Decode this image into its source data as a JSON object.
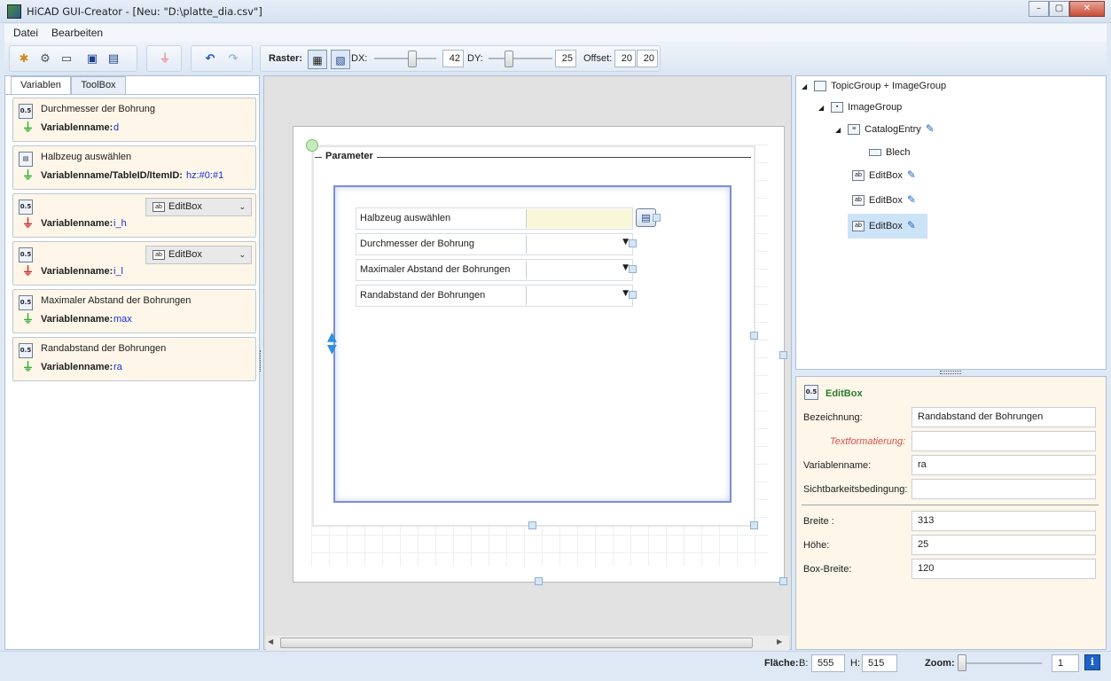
{
  "window": {
    "title": "HiCAD GUI-Creator - [Neu: \"D:\\platte_dia.csv\"]",
    "min": "–",
    "max": "▢",
    "close": "✕"
  },
  "menu": {
    "file": "Datei",
    "edit": "Bearbeiten"
  },
  "toolbar": {
    "raster_label": "Raster:",
    "dx_label": "DX:",
    "dx_value": "42",
    "dy_label": "DY:",
    "dy_value": "25",
    "offset_label": "Offset:",
    "offset_x": "20",
    "offset_y": "20"
  },
  "tabs": {
    "variables": "Variablen",
    "toolbox": "ToolBox"
  },
  "variables": [
    {
      "title": "Durchmesser der Bohrung",
      "label": "Variablenname:",
      "value": "d",
      "plug": "green"
    },
    {
      "title": "Halbzeug auswählen",
      "label": "Variablenname/TableID/ItemID:",
      "value": "hz:#0:#1",
      "plug": "green"
    },
    {
      "combo": "EditBox",
      "label": "Variablenname:",
      "value": "i_h",
      "plug": "red"
    },
    {
      "combo": "EditBox",
      "label": "Variablenname:",
      "value": "i_l",
      "plug": "red"
    },
    {
      "title": "Maximaler Abstand der Bohrungen",
      "label": "Variablenname:",
      "value": "max",
      "plug": "green"
    },
    {
      "title": "Randabstand der Bohrungen",
      "label": "Variablenname:",
      "value": "ra",
      "plug": "green"
    }
  ],
  "form": {
    "group_title": "Parameter",
    "fields": [
      "Halbzeug auswählen",
      "Durchmesser der Bohrung",
      "Maximaler Abstand der Bohrungen",
      "Randabstand der Bohrungen"
    ]
  },
  "tree": {
    "root": "TopicGroup + ImageGroup",
    "image_group": "ImageGroup",
    "catalog_entry": "CatalogEntry",
    "blech": "Blech",
    "editbox1": "EditBox",
    "editbox2": "EditBox",
    "editbox3": "EditBox"
  },
  "properties": {
    "type": "EditBox",
    "bezeichnung_label": "Bezeichnung:",
    "bezeichnung_value": "Randabstand der Bohrungen",
    "textformat_label": "Textformatierung:",
    "textformat_value": "",
    "variablenname_label": "Variablenname:",
    "variablenname_value": "ra",
    "sichtbarkeit_label": "Sichtbarkeitsbedingung:",
    "sichtbarkeit_value": "",
    "breite_label": "Breite :",
    "breite_value": "313",
    "hoehe_label": "Höhe:",
    "hoehe_value": "25",
    "boxbreite_label": "Box-Breite:",
    "boxbreite_value": "120"
  },
  "status": {
    "flaeche_label": "Fläche:",
    "b_label": "B:",
    "b_value": "555",
    "h_label": "H:",
    "h_value": "515",
    "zoom_label": "Zoom:",
    "zoom_value": "1",
    "info": "i"
  },
  "colors": {
    "accent": "#1f62c7",
    "card_bg": "#fdf6e9",
    "plug_green": "#2fb22f",
    "plug_red": "#d62727"
  }
}
